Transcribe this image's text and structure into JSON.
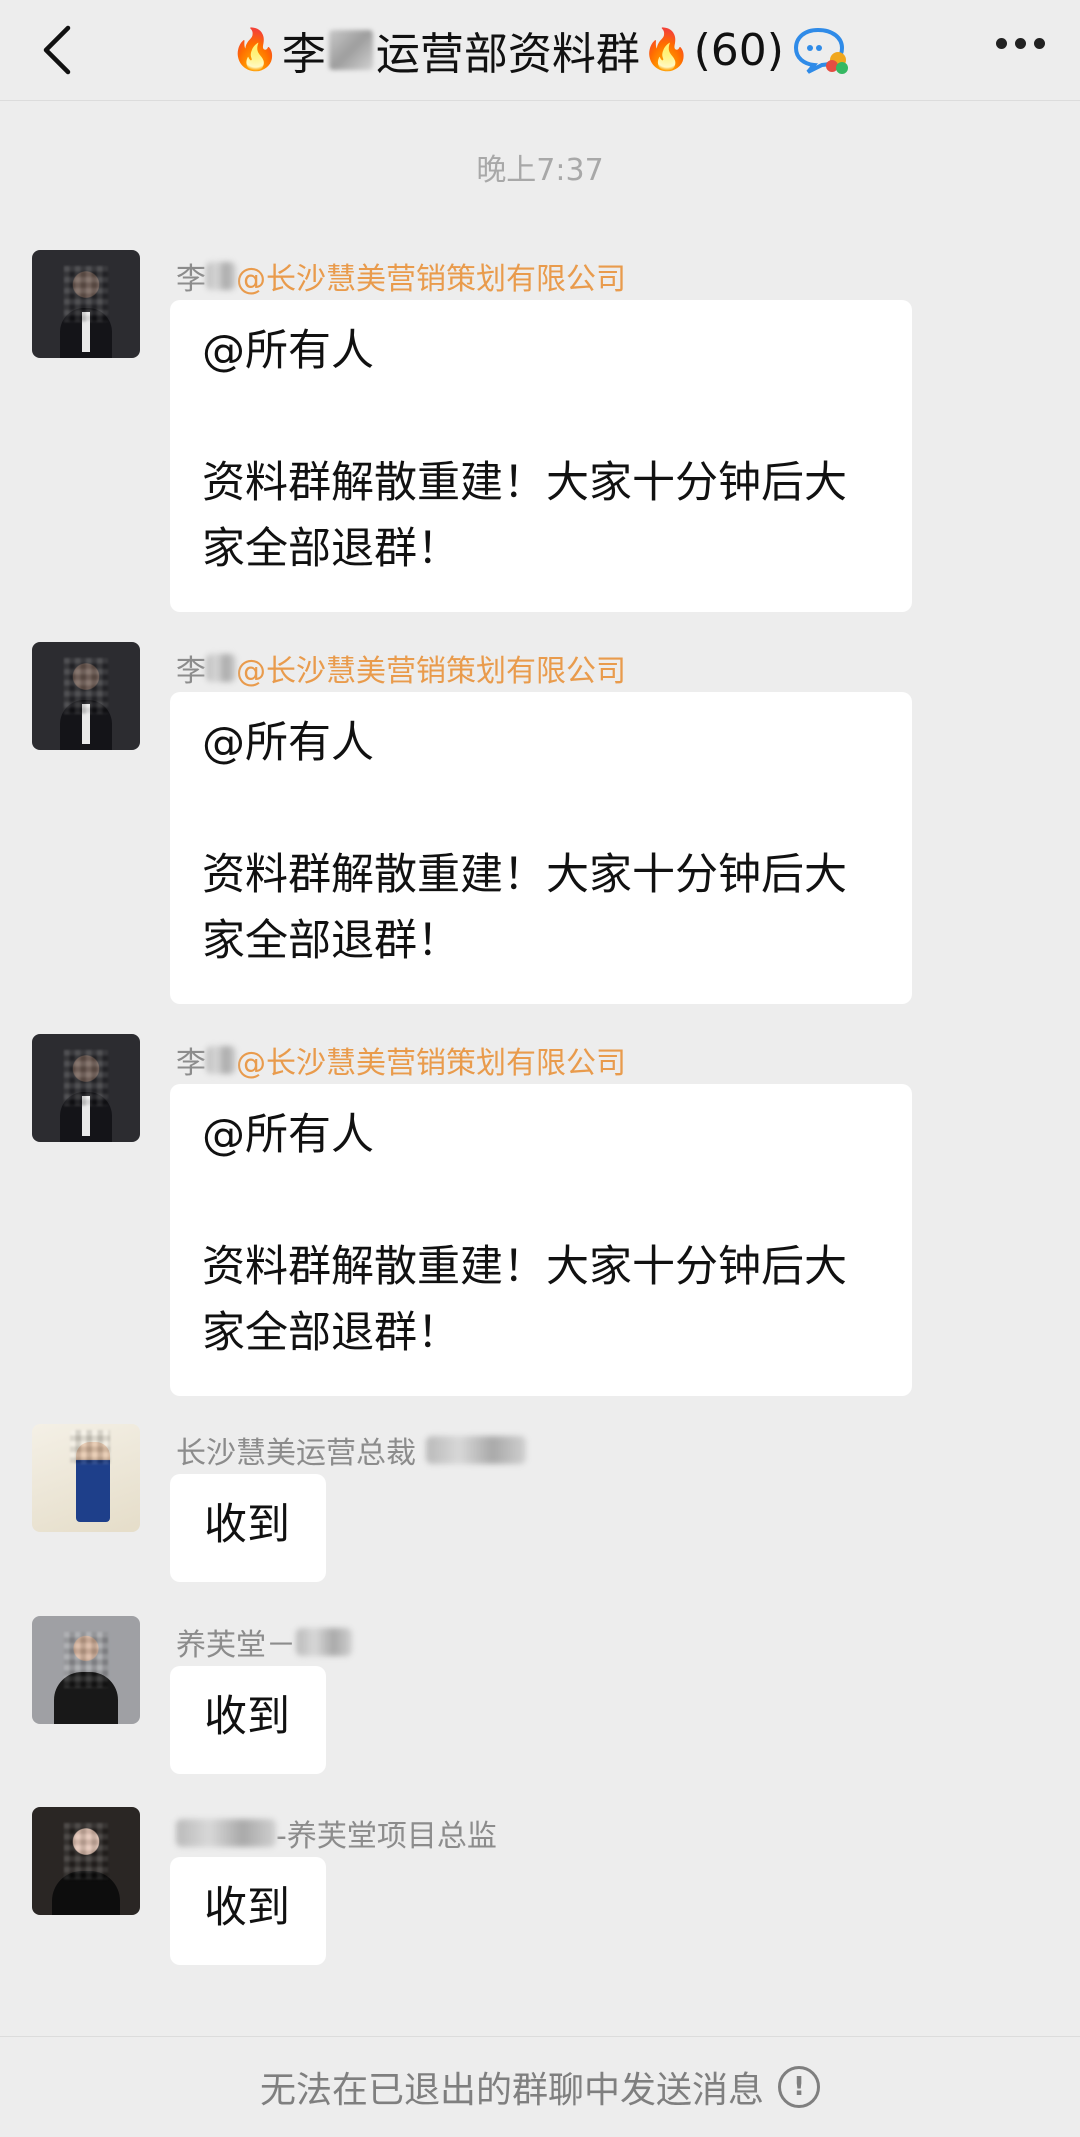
{
  "header": {
    "title_prefix": "李",
    "title_suffix": "运营部资料群",
    "member_count": "(60)",
    "fire_emoji": "🔥",
    "icons": [
      "back-arrow-icon",
      "fire-emoji-icon",
      "group-chat-icon",
      "more-dots-icon"
    ]
  },
  "timestamp": "晚上7:37",
  "messages": [
    {
      "sender_name": "李",
      "sender_org": "@长沙慧美营销策划有限公司",
      "text": "@所有人\n\n资料群解散重建！大家十分钟后大家全部退群！"
    },
    {
      "sender_name": "李",
      "sender_org": "@长沙慧美营销策划有限公司",
      "text": "@所有人\n\n资料群解散重建！大家十分钟后大家全部退群！"
    },
    {
      "sender_name": "李",
      "sender_org": "@长沙慧美营销策划有限公司",
      "text": "@所有人\n\n资料群解散重建！大家十分钟后大家全部退群！"
    },
    {
      "sender_name": "长沙慧美运营总裁",
      "sender_org": "",
      "text": "收到"
    },
    {
      "sender_name": "养芙堂－",
      "sender_org": "",
      "text": "收到"
    },
    {
      "sender_name": "-养芙堂项目总监",
      "sender_org": "",
      "text": "收到"
    }
  ],
  "footer": {
    "notice": "无法在已退出的群聊中发送消息",
    "icon": "info-circle-icon",
    "icon_glyph": "!"
  }
}
